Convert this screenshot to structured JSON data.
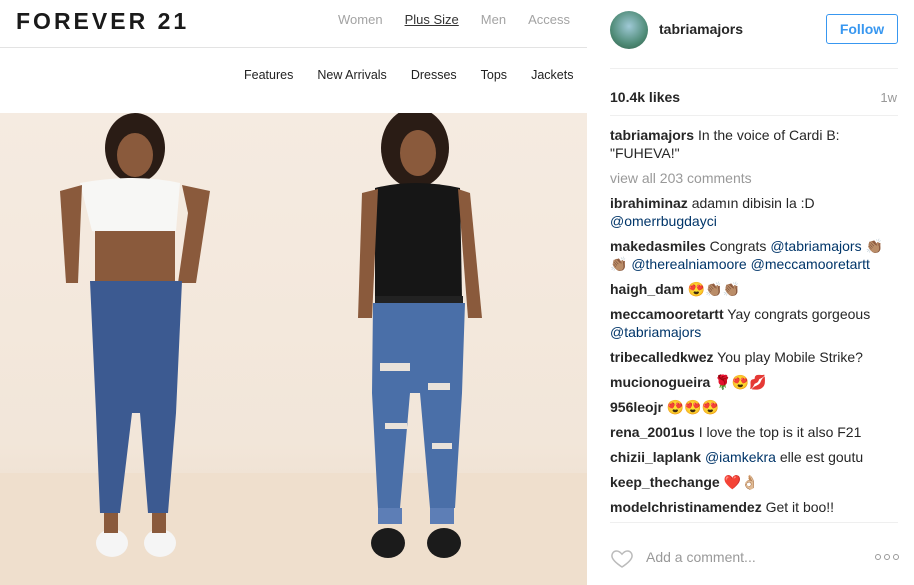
{
  "post_image": {
    "logo": "FOREVER 21",
    "main_nav": [
      "Women",
      "Plus Size",
      "Men",
      "Access"
    ],
    "main_nav_active": "Plus Size",
    "sub_nav": [
      "Features",
      "New Arrivals",
      "Dresses",
      "Tops",
      "Jackets"
    ]
  },
  "header": {
    "username": "tabriamajors",
    "follow_label": "Follow"
  },
  "stats": {
    "likes": "10.4k likes",
    "time": "1w"
  },
  "caption": {
    "username": "tabriamajors",
    "text": "In the voice of Cardi B: \"FUHEVA!\""
  },
  "view_all": "view all 203 comments",
  "comments": [
    {
      "user": "ibrahiminaz",
      "text": "adamın dibisin la :D",
      "mention": "@omerrbugdayci"
    },
    {
      "user": "makedasmiles",
      "text": "Congrats",
      "mention": "@tabriamajors",
      "extra": "👏🏽👏🏽",
      "mention2": "@therealniamoore",
      "mention3": "@meccamooretartt"
    },
    {
      "user": "haigh_dam",
      "text": "😍👏🏽👏🏽"
    },
    {
      "user": "meccamooretartt",
      "text": "Yay congrats gorgeous",
      "mention": "@tabriamajors"
    },
    {
      "user": "tribecalledkwez",
      "text": "You play Mobile Strike?"
    },
    {
      "user": "mucionogueira",
      "text": "🌹😍💋"
    },
    {
      "user": "956leojr",
      "text": "😍😍😍"
    },
    {
      "user": "rena_2001us",
      "text": "I love the top is it also F21"
    },
    {
      "user": "chizii_laplank",
      "mention": "@iamkekra",
      "text": "elle est goutu"
    },
    {
      "user": "keep_thechange",
      "text": "❤️👌🏼"
    },
    {
      "user": "modelchristinamendez",
      "text": "Get it boo!!"
    }
  ],
  "footer": {
    "placeholder": "Add a comment..."
  },
  "colors": {
    "accent": "#3897f0",
    "mention": "#003569",
    "muted": "#999999"
  },
  "icons": {
    "like": "heart-icon",
    "more": "more-options-icon"
  }
}
